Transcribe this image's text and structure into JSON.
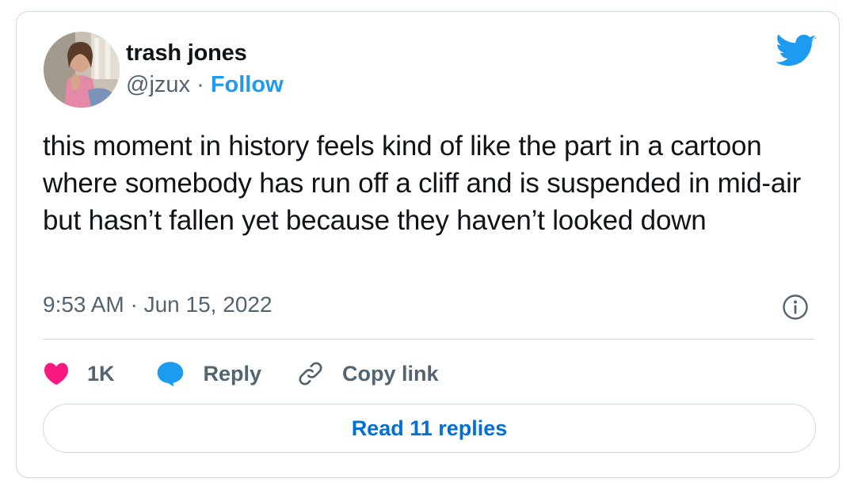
{
  "author": {
    "display_name": "trash jones",
    "handle": "@jzux",
    "separator": "·",
    "follow_label": "Follow"
  },
  "tweet": {
    "text": "this moment in history feels kind of like the part in a cartoon where somebody has run off a cliff and is suspended in mid-air but hasn’t fallen yet because they haven’t looked down",
    "timestamp": "9:53 AM · Jun 15, 2022"
  },
  "actions": {
    "like_count": "1K",
    "reply_label": "Reply",
    "copy_link_label": "Copy link",
    "read_replies_label": "Read 11 replies"
  },
  "icons": {
    "brand": "twitter-bird-icon",
    "info": "info-icon",
    "like": "heart-icon",
    "reply": "speech-bubble-icon",
    "copy": "link-icon"
  },
  "colors": {
    "brand_blue": "#1d9bf0",
    "link_blue": "#006fd6",
    "like_pink": "#f91880",
    "text_primary": "#0f1419",
    "text_secondary": "#536471",
    "border": "#cfd9de"
  }
}
